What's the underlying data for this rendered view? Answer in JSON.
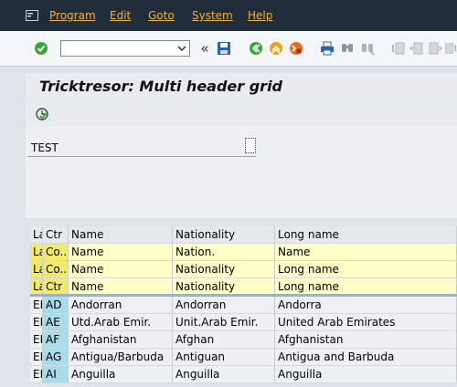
{
  "menu": {
    "items": [
      "Program",
      "Edit",
      "Goto",
      "System",
      "Help"
    ]
  },
  "toolbar": {
    "command_value": "",
    "icons": [
      "enter-icon",
      "command-dropdown-icon",
      "history-back-icon",
      "save-icon",
      "back-icon",
      "exit-icon",
      "cancel-icon",
      "print-icon",
      "find-icon",
      "find-next-icon",
      "first-page-icon",
      "previous-page-icon",
      "next-page-icon",
      "last-page-icon"
    ]
  },
  "title": {
    "text": "Tricktresor: Multi header grid"
  },
  "app_toolbar": {
    "icons": [
      "execute-icon"
    ]
  },
  "form": {
    "label": "TEST",
    "value": ""
  },
  "grid": {
    "headers": [
      "La",
      "Ctr",
      "Name",
      "Nationality",
      "Long name"
    ],
    "header_rows": [
      [
        "La",
        "Co...",
        "Name",
        "Nation.",
        "Name"
      ],
      [
        "La",
        "Co...",
        "Name",
        "Nationality",
        "Long name"
      ],
      [
        "La",
        "Ctr",
        "Name",
        "Nationality",
        "Long name"
      ]
    ],
    "rows": [
      [
        "EI",
        "AD",
        "Andorran",
        "Andorran",
        "Andorra"
      ],
      [
        "EI",
        "AE",
        "Utd.Arab Emir.",
        "Unit.Arab Emir.",
        "United Arab Emirates"
      ],
      [
        "EI",
        "AF",
        "Afghanistan",
        "Afghan",
        "Afghanistan"
      ],
      [
        "EI",
        "AG",
        "Antigua/Barbuda",
        "Antiguan",
        "Antigua and Barbuda"
      ],
      [
        "EI",
        "AI",
        "Anguilla",
        "Anguilla",
        "Anguilla"
      ]
    ]
  },
  "colors": {
    "menubar": "#1f2d3a",
    "menu_text": "#f0b040",
    "header_yellow": "#ffffc8",
    "key_column": "#a9dceb"
  }
}
